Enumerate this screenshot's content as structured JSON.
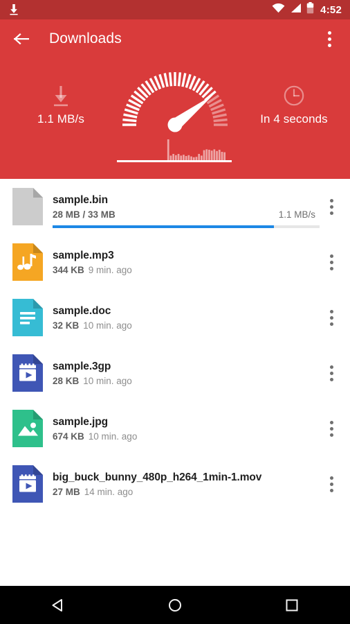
{
  "status_bar": {
    "background": "#b33130",
    "download_icon": "download-notification-icon",
    "wifi_icon": "wifi-icon",
    "signal_icon": "cellular-signal-icon",
    "battery_icon": "battery-icon",
    "time": "4:52"
  },
  "app_bar": {
    "background": "#d93b3b",
    "back_icon": "back-arrow-icon",
    "title": "Downloads",
    "overflow_icon": "overflow-menu-icon"
  },
  "gauge_panel": {
    "background": "#d93b3b",
    "speed": {
      "icon": "download-speed-icon",
      "label": "1.1 MB/s"
    },
    "eta": {
      "icon": "clock-icon",
      "label": "In 4 seconds"
    },
    "gauge": {
      "needle_angle_deg": 38,
      "tick_count": 33,
      "active_ticks": 26,
      "accent": "#ffffff"
    },
    "histogram": {
      "values": [
        0,
        0,
        0,
        0,
        0,
        0,
        0,
        0,
        0,
        0,
        0,
        0,
        0,
        0,
        0,
        0,
        0,
        100,
        22,
        30,
        24,
        30,
        22,
        26,
        20,
        24,
        18,
        14,
        16,
        30,
        22,
        48,
        52,
        50,
        46,
        52,
        44,
        50,
        40,
        38
      ],
      "baseline_color": "#ffffff"
    }
  },
  "file_list": {
    "rows": [
      {
        "name": "sample.bin",
        "icon": "file-generic-icon",
        "icon_color": "#cccccc",
        "size": "28 MB / 33 MB",
        "time": "",
        "speed": "1.1 MB/s",
        "progress_percent": 83,
        "progress_color": "#1d88e5",
        "overflow_icon": "overflow-menu-icon"
      },
      {
        "name": "sample.mp3",
        "icon": "file-audio-icon",
        "icon_color": "#f5a623",
        "size": "344 KB",
        "time": "9 min. ago",
        "speed": "",
        "progress_percent": null,
        "overflow_icon": "overflow-menu-icon"
      },
      {
        "name": "sample.doc",
        "icon": "file-document-icon",
        "icon_color": "#36bcd4",
        "size": "32 KB",
        "time": "10 min. ago",
        "speed": "",
        "progress_percent": null,
        "overflow_icon": "overflow-menu-icon"
      },
      {
        "name": "sample.3gp",
        "icon": "file-video-icon",
        "icon_color": "#3f56b5",
        "size": "28 KB",
        "time": "10 min. ago",
        "speed": "",
        "progress_percent": null,
        "overflow_icon": "overflow-menu-icon"
      },
      {
        "name": "sample.jpg",
        "icon": "file-image-icon",
        "icon_color": "#2ec08b",
        "size": "674 KB",
        "time": "10 min. ago",
        "speed": "",
        "progress_percent": null,
        "overflow_icon": "overflow-menu-icon"
      },
      {
        "name": "big_buck_bunny_480p_h264_1min-1.mov",
        "icon": "file-video-icon",
        "icon_color": "#3f56b5",
        "size": "27 MB",
        "time": "14 min. ago",
        "speed": "",
        "progress_percent": null,
        "overflow_icon": "overflow-menu-icon"
      }
    ]
  },
  "nav_bar": {
    "background": "#000000",
    "back": "navigation-back-icon",
    "home": "navigation-home-icon",
    "recents": "navigation-recents-icon"
  }
}
